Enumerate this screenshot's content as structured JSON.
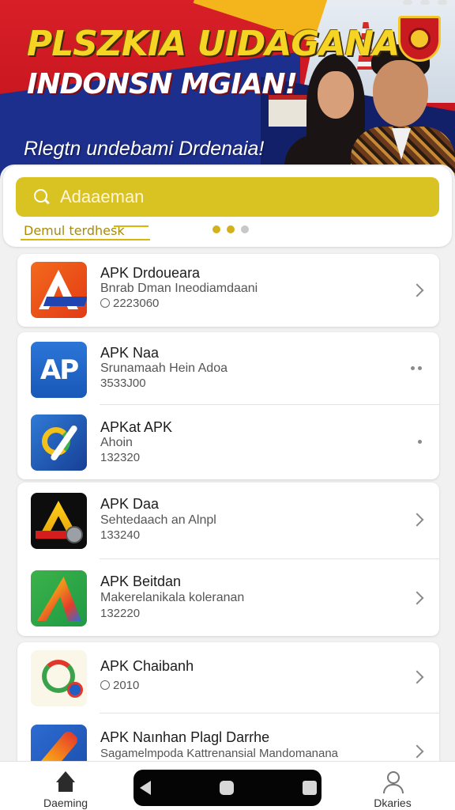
{
  "banner": {
    "title_line1": "PLSZKIA UIDAGANA",
    "title_line2": "INDONSN MGIAN!",
    "subtitle": "Rlegtn undebami Drdenaia!"
  },
  "search": {
    "placeholder": "Adaaeman"
  },
  "carousel": {
    "label": "Demul terdhesk",
    "total_pages": 3,
    "active_page": 1
  },
  "apps": [
    {
      "title": "APK Drdoueara",
      "subtitle": "Bnrab Dman Ineodiamdaani",
      "meta": "2223060",
      "icon": "apk-drdoueara-icon",
      "action": "chevron"
    },
    {
      "title": "APK Naa",
      "subtitle": "Srunamaah Hein Adoa",
      "meta": "3533J00",
      "icon": "apk-naa-icon",
      "icon_text": "AP",
      "action": "more"
    },
    {
      "title": "APKat APK",
      "subtitle": "Ahoin",
      "meta": "132320",
      "icon": "apkat-apk-icon",
      "action": "more"
    },
    {
      "title": "APK Daa",
      "subtitle": "Sehtedaach an Alnpl",
      "meta": "133240",
      "icon": "apk-daa-icon",
      "action": "chevron"
    },
    {
      "title": "APK Beitdan",
      "subtitle": "Makerelanikala koleranan",
      "meta": "132220",
      "icon": "apk-beitdan-icon",
      "action": "chevron"
    },
    {
      "title": "APK Chaibanh",
      "subtitle": "",
      "meta": "2010",
      "icon": "apk-chaibanh-icon",
      "action": "chevron"
    },
    {
      "title": "APK Naınhan Plagl Darrhe",
      "subtitle": "Sagamelmpoda Kattrenansial Mandomanana",
      "meta": "",
      "icon": "apk-nainhan-icon",
      "action": "chevron"
    }
  ],
  "bottom_nav": {
    "home_label": "Daeming",
    "profile_label": "Dkaries"
  },
  "colors": {
    "accent_yellow": "#d9c322",
    "banner_red": "#c8161f",
    "banner_blue": "#1d2f8c"
  }
}
